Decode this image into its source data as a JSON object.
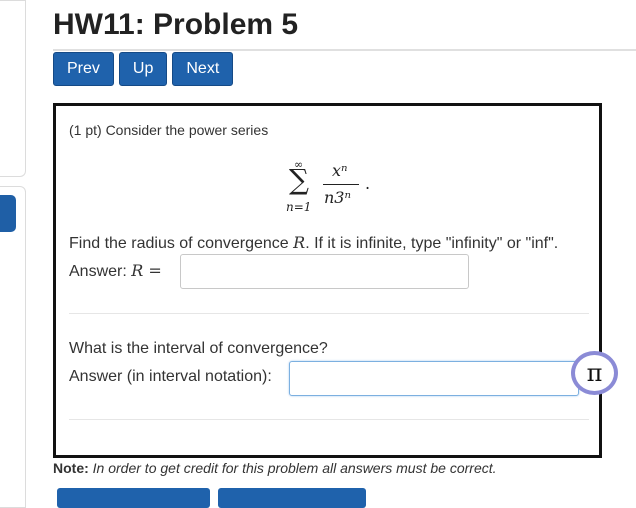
{
  "page": {
    "title": "HW11: Problem 5"
  },
  "nav": {
    "prev": "Prev",
    "up": "Up",
    "next": "Next"
  },
  "problem": {
    "intro": "(1 pt) Consider the power series",
    "series": {
      "sum_symbol": "∑",
      "upper": "∞",
      "lower": "n=1",
      "numerator": "xⁿ",
      "denominator": "n3ⁿ",
      "trailing": "."
    },
    "q1_text_before": "Find the radius of convergence ",
    "q1_var": "R",
    "q1_text_after": ". If it is infinite, type \"infinity\" or \"inf\".",
    "answer1_label": "Answer: ",
    "answer1_var": "R",
    "answer1_eq": " =",
    "answer1_value": "",
    "q2_text": "What is the interval of convergence?",
    "answer2_label": "Answer (in interval notation):",
    "answer2_value": ""
  },
  "equation_editor": {
    "icon": "pi-icon",
    "glyph": "π"
  },
  "note": {
    "label": "Note:",
    "text": " In order to get credit for this problem all answers must be correct."
  },
  "colors": {
    "button_blue": "#1f62ac",
    "pi_ring": "#8b8bd6",
    "focused_input_border": "#7cb0e0"
  }
}
